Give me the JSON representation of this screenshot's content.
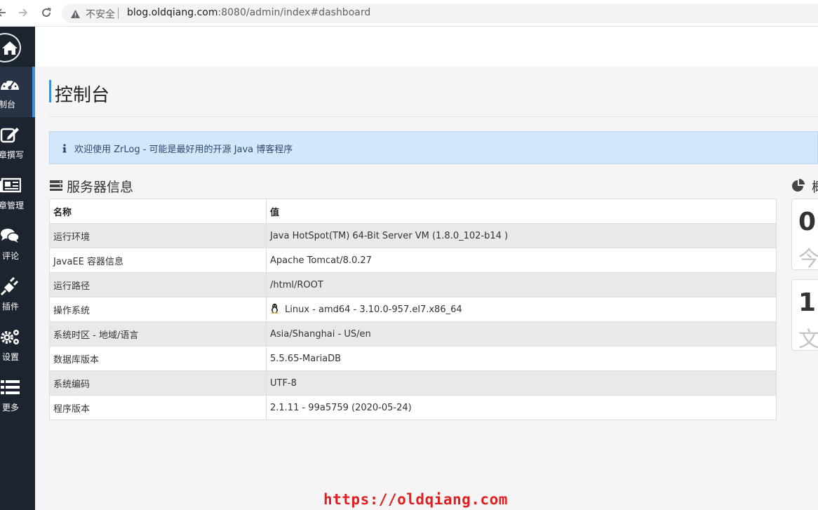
{
  "browser": {
    "security_label": "不安全",
    "url_host": "blog.oldqiang.com",
    "url_rest": ":8080/admin/index#dashboard"
  },
  "sidebar": {
    "items": [
      {
        "label": "控制台",
        "icon": "dashboard-icon",
        "active": true
      },
      {
        "label": "文章撰写",
        "icon": "edit-icon",
        "active": false
      },
      {
        "label": "文章管理",
        "icon": "newspaper-icon",
        "active": false
      },
      {
        "label": "评论",
        "icon": "comments-icon",
        "active": false
      },
      {
        "label": "插件",
        "icon": "plug-icon",
        "active": false
      },
      {
        "label": "设置",
        "icon": "gears-icon",
        "active": false
      },
      {
        "label": "更多",
        "icon": "list-icon",
        "active": false
      }
    ]
  },
  "page": {
    "title": "控制台",
    "alert": "欢迎使用 ZrLog - 可能是最好用的开源 Java 博客程序"
  },
  "server_info": {
    "title": "服务器信息",
    "headers": [
      "名称",
      "值"
    ],
    "rows": [
      {
        "name": "运行环境",
        "value": "Java HotSpot(TM) 64-Bit Server VM (1.8.0_102-b14 )"
      },
      {
        "name": "JavaEE 容器信息",
        "value": "Apache Tomcat/8.0.27"
      },
      {
        "name": "运行路径",
        "value": "/html/ROOT"
      },
      {
        "name": "操作系统",
        "value": "Linux - amd64 - 3.10.0-957.el7.x86_64"
      },
      {
        "name": "系统时区 - 地域/语言",
        "value": "Asia/Shanghai - US/en"
      },
      {
        "name": "数据库版本",
        "value": "5.5.65-MariaDB"
      },
      {
        "name": "系统编码",
        "value": "UTF-8"
      },
      {
        "name": "程序版本",
        "value": "2.1.11 - 99a5759 (2020-05-24)"
      }
    ]
  },
  "stats": {
    "title": "概",
    "cards": [
      {
        "value": "0",
        "label": "今"
      },
      {
        "value": "1",
        "label": "文"
      }
    ]
  },
  "watermark": "https://oldqiang.com",
  "colors": {
    "sidebar_bg": "#1c2430",
    "accent": "#3f8dde",
    "alert_bg": "#d4e6fa",
    "watermark": "#e02020"
  }
}
